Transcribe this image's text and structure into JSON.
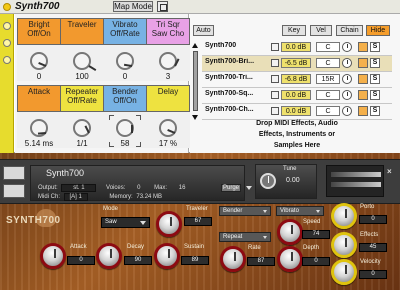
{
  "top_panel": {
    "title": "Synth700",
    "map_mode_label": "Map Mode",
    "macros": [
      {
        "label": "Bright\nOff/On",
        "value": "0",
        "color": "orange",
        "dial": 25
      },
      {
        "label": "Traveler",
        "value": "100",
        "color": "orange",
        "dial": 95
      },
      {
        "label": "Vibrato\nOff/Rate",
        "value": "0",
        "color": "blue",
        "dial": 20
      },
      {
        "label": "Tri Sqr\nSaw Cho",
        "value": "3",
        "color": "pink",
        "dial": 60
      },
      {
        "label": "Attack",
        "value": "5.14 ms",
        "color": "orange",
        "dial": 15
      },
      {
        "label": "Repeater\nOff/Rate",
        "value": "1/1",
        "color": "yellow",
        "dial": 40
      },
      {
        "label": "Bender\nOff/On",
        "value": "58",
        "color": "blue",
        "dial": 50
      },
      {
        "label": "Delay",
        "value": "17 %",
        "color": "yellow",
        "dial": 25
      }
    ],
    "device": {
      "auto_label": "Auto",
      "key_label": "Key",
      "vel_label": "Vel",
      "chain_label": "Chain",
      "hide_label": "Hide",
      "chains": [
        {
          "name": "Synth700",
          "db": "0.0 dB",
          "pan": "C",
          "solo": "S",
          "highlight": false
        },
        {
          "name": "Synth700-Bri...",
          "db": "-6.5 dB",
          "pan": "C",
          "solo": "S",
          "highlight": true
        },
        {
          "name": "Synth700-Tri...",
          "db": "-6.8 dB",
          "pan": "15R",
          "solo": "S",
          "highlight": false
        },
        {
          "name": "Synth700-Sq...",
          "db": "0.0 dB",
          "pan": "C",
          "solo": "S",
          "highlight": false
        },
        {
          "name": "Synth700-Ch...",
          "db": "0.0 dB",
          "pan": "C",
          "solo": "S",
          "highlight": false
        }
      ],
      "drop_text_1": "Drop MIDI Effects, Audio",
      "drop_text_2": "Effects, Instruments or",
      "drop_text_3": "Samples Here"
    }
  },
  "bottom_panel": {
    "header": {
      "instrument_name": "Synth700",
      "output_label": "Output:",
      "output_value": "st. 1",
      "voices_label": "Voices:",
      "voices_value": "0",
      "max_label": "Max:",
      "max_value": "16",
      "purge_label": "Purge",
      "midi_label": "Midi Ch:",
      "midi_value": "[A] 1",
      "memory_label": "Memory:",
      "memory_value": "73.24 MB",
      "tune_label": "Tune",
      "tune_value": "0.00"
    },
    "logo": "SYNTH700",
    "controls": {
      "mode_label": "Mode",
      "mode_value": "Saw",
      "traveler_label": "Traveler",
      "traveler_value": "67",
      "bender_label": "Bender",
      "repeat_label": "Repeat",
      "rate_label": "Rate",
      "rate_value": "87",
      "vibrato_label": "Vibrato",
      "speed_label": "Speed",
      "speed_value": "74",
      "depth_label": "Depth",
      "depth_value": "0",
      "porto_label": "Porto",
      "porto_value": "0",
      "effects_label": "Effects",
      "effects_value": "45",
      "velocity_label": "Velocity",
      "velocity_value": "0",
      "attack_label": "Attack",
      "attack_value": "0",
      "decay_label": "Decay",
      "decay_value": "90",
      "sustain_label": "Sustain",
      "sustain_value": "89"
    }
  }
}
